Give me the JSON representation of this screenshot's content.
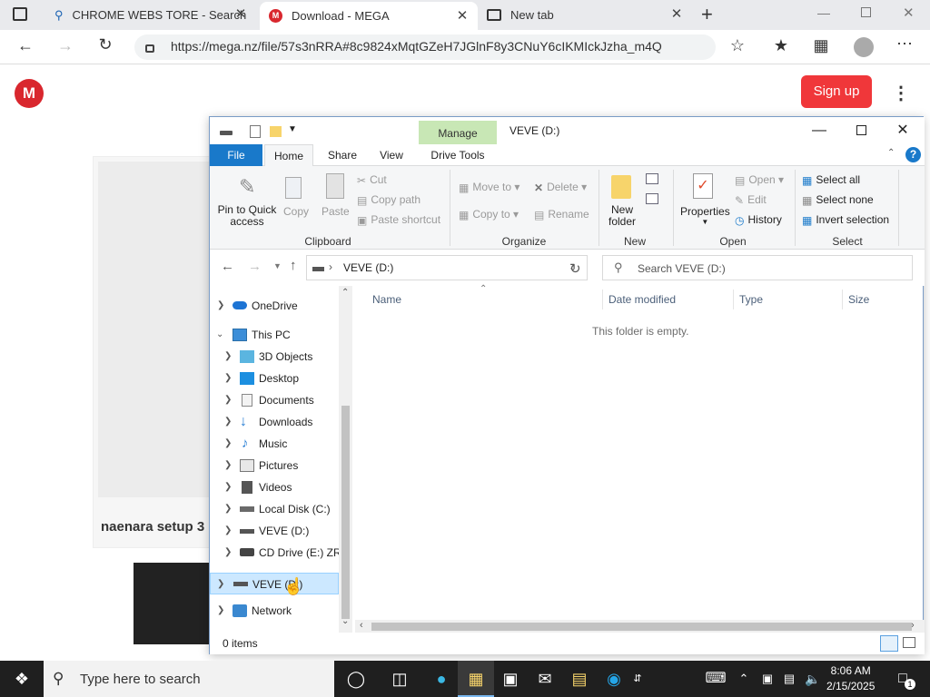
{
  "browser": {
    "tabs": [
      {
        "label": "CHROME WEBS TORE - Search"
      },
      {
        "label": "Download - MEGA"
      },
      {
        "label": "New tab"
      }
    ],
    "url": "https://mega.nz/file/57s3nRRA#8c9824xMqtGZeH7JGlnF8y3CNuY6cIKMIckJzha_m4Q"
  },
  "mega": {
    "logo": "M",
    "signup": "Sign up",
    "filename": "naenara setup 3"
  },
  "explorer": {
    "manage": "Manage",
    "title": "VEVE (D:)",
    "tabs": {
      "file": "File",
      "home": "Home",
      "share": "Share",
      "view": "View",
      "drive_tools": "Drive Tools"
    },
    "ribbon": {
      "pin": [
        "Pin to Quick",
        "access"
      ],
      "copy": "Copy",
      "paste": "Paste",
      "cut": "Cut",
      "copy_path": "Copy path",
      "paste_shortcut": "Paste shortcut",
      "move_to": "Move to",
      "copy_to": "Copy to",
      "delete": "Delete",
      "rename": "Rename",
      "new_folder": [
        "New",
        "folder"
      ],
      "properties": "Properties",
      "open": "Open",
      "edit": "Edit",
      "history": "History",
      "select_all": "Select all",
      "select_none": "Select none",
      "invert_selection": "Invert selection",
      "groups": {
        "clipboard": "Clipboard",
        "organize": "Organize",
        "new": "New",
        "open": "Open",
        "select": "Select"
      }
    },
    "path": "VEVE (D:)",
    "search_placeholder": "Search VEVE (D:)",
    "tree": [
      {
        "label": "OneDrive"
      },
      {
        "label": "This PC"
      },
      {
        "label": "3D Objects"
      },
      {
        "label": "Desktop"
      },
      {
        "label": "Documents"
      },
      {
        "label": "Downloads"
      },
      {
        "label": "Music"
      },
      {
        "label": "Pictures"
      },
      {
        "label": "Videos"
      },
      {
        "label": "Local Disk (C:)"
      },
      {
        "label": "VEVE (D:)"
      },
      {
        "label": "CD Drive (E:) ZRM"
      },
      {
        "label": "VEVE (D:)"
      },
      {
        "label": "Network"
      }
    ],
    "columns": {
      "name": "Name",
      "date": "Date modified",
      "type": "Type",
      "size": "Size"
    },
    "empty_message": "This folder is empty.",
    "status": "0 items"
  },
  "taskbar": {
    "search_placeholder": "Type here to search",
    "time": "8:06 AM",
    "date": "2/15/2025",
    "notification_count": "1"
  },
  "colors": {
    "accent": "#1979ca",
    "mega_red": "#d9272e",
    "manage_green": "#c8e7b5",
    "selection": "#cce8ff"
  }
}
